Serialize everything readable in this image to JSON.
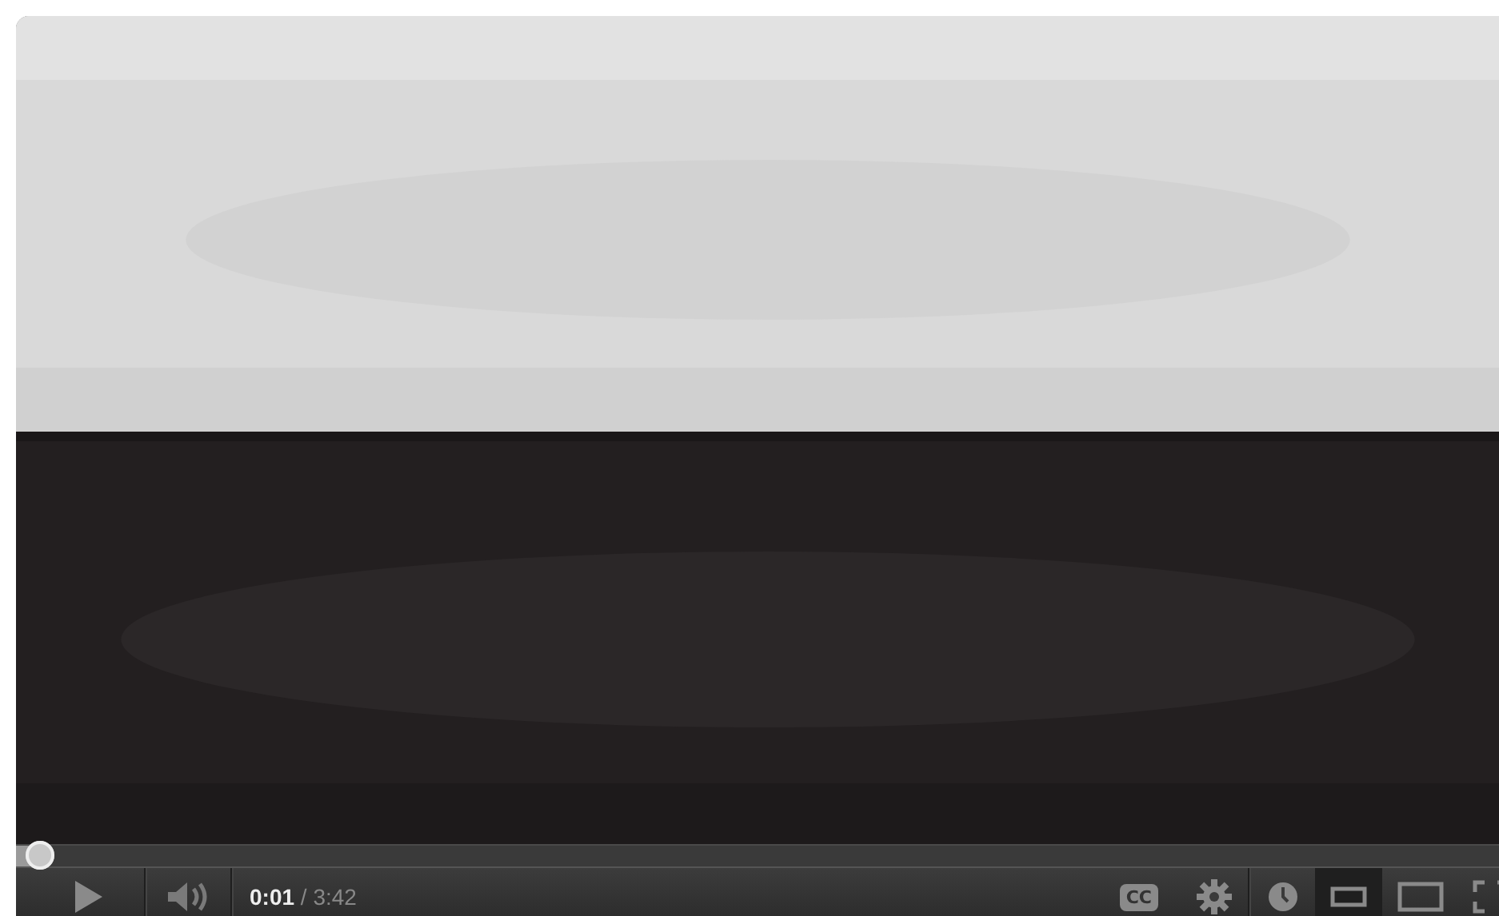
{
  "progress": {
    "level": 0.016
  },
  "controls": {
    "current_time": "0:01",
    "separator": "/",
    "duration": "3:42",
    "captions_label": "CC",
    "sizes": [
      {
        "kind": "small",
        "selected": true
      },
      {
        "kind": "large",
        "selected": false
      }
    ]
  }
}
